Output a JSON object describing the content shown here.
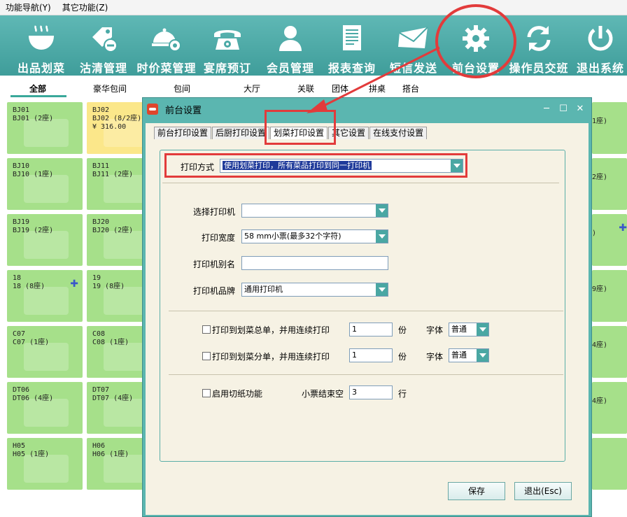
{
  "menubar": {
    "items": [
      "功能导航(Y)",
      "其它功能(Z)"
    ]
  },
  "toolbar": {
    "buttons": [
      {
        "label": "出品划菜",
        "icon": "bowl-icon"
      },
      {
        "label": "沽清管理",
        "icon": "tag-icon"
      },
      {
        "label": "时价菜管理",
        "icon": "cloche-gear-icon"
      },
      {
        "label": "宴席预订",
        "icon": "telephone-icon"
      },
      {
        "label": "会员管理",
        "icon": "person-icon"
      },
      {
        "label": "报表查询",
        "icon": "document-icon"
      },
      {
        "label": "短信发送",
        "icon": "envelope-icon"
      },
      {
        "label": "前台设置",
        "icon": "gear-icon"
      },
      {
        "label": "操作员交班",
        "icon": "refresh-icon"
      },
      {
        "label": "退出系统",
        "icon": "power-icon"
      }
    ]
  },
  "categories": [
    "全部",
    "豪华包间",
    "包间",
    "大厅",
    "关联",
    "团体",
    "拼桌",
    "搭台"
  ],
  "tables": [
    {
      "code": "BJ01",
      "name": "BJ01 (2座)"
    },
    {
      "code": "BJ02",
      "name": "BJ02 (8/2座)",
      "amount": "¥ 316.00"
    },
    {
      "code": "BJ10",
      "name": "BJ10 (1座)"
    },
    {
      "code": "BJ11",
      "name": "BJ11 (2座)"
    },
    {
      "code": "BJ19",
      "name": "BJ19 (2座)"
    },
    {
      "code": "BJ20",
      "name": "BJ20 (2座)"
    },
    {
      "code": "18",
      "name": "18 (8座)"
    },
    {
      "code": "19",
      "name": "19 (8座)"
    },
    {
      "code": "C07",
      "name": "C07 (1座)"
    },
    {
      "code": "C08",
      "name": "C08 (1座)"
    },
    {
      "code": "DT06",
      "name": "DT06 (4座)"
    },
    {
      "code": "DT07",
      "name": "DT07 (4座)"
    },
    {
      "code": "H05",
      "name": "H05 (1座)"
    },
    {
      "code": "H06",
      "name": "H06 (1座)"
    }
  ],
  "right_edge_labels": [
    "1座)",
    "2座)",
    ")",
    "9座)",
    "4座)",
    "4座)"
  ],
  "dialog": {
    "title": "前台设置",
    "tabs": [
      "前台打印设置",
      "后厨打印设置",
      "划菜打印设置",
      "其它设置",
      "在线支付设置"
    ],
    "print_mode_label": "打印方式",
    "print_mode_value": "使用划菜打印，所有菜品打印到同一打印机",
    "select_printer_label": "选择打印机",
    "select_printer_value": "",
    "print_width_label": "打印宽度",
    "print_width_value": "58 mm小票(最多32个字符)",
    "printer_alias_label": "打印机别名",
    "printer_alias_value": "",
    "printer_brand_label": "打印机品牌",
    "printer_brand_value": "通用打印机",
    "summary_print_label": "打印到划菜总单，并用连续打印",
    "summary_copies": "1",
    "detail_print_label": "打印到划菜分单，并用连续打印",
    "detail_copies": "1",
    "copies_unit": "份",
    "font_label": "字体",
    "font_value": "普通",
    "cut_label": "启用切纸功能",
    "end_blank_label": "小票结束空",
    "end_blank_value": "3",
    "end_blank_unit": "行",
    "save_label": "保存",
    "exit_label": "退出(Esc)"
  },
  "colors": {
    "toolbar": "#4aa9a6",
    "tile_free": "#a6e08a",
    "tile_occupied": "#fbe78a",
    "annotation": "#e23b3b"
  }
}
